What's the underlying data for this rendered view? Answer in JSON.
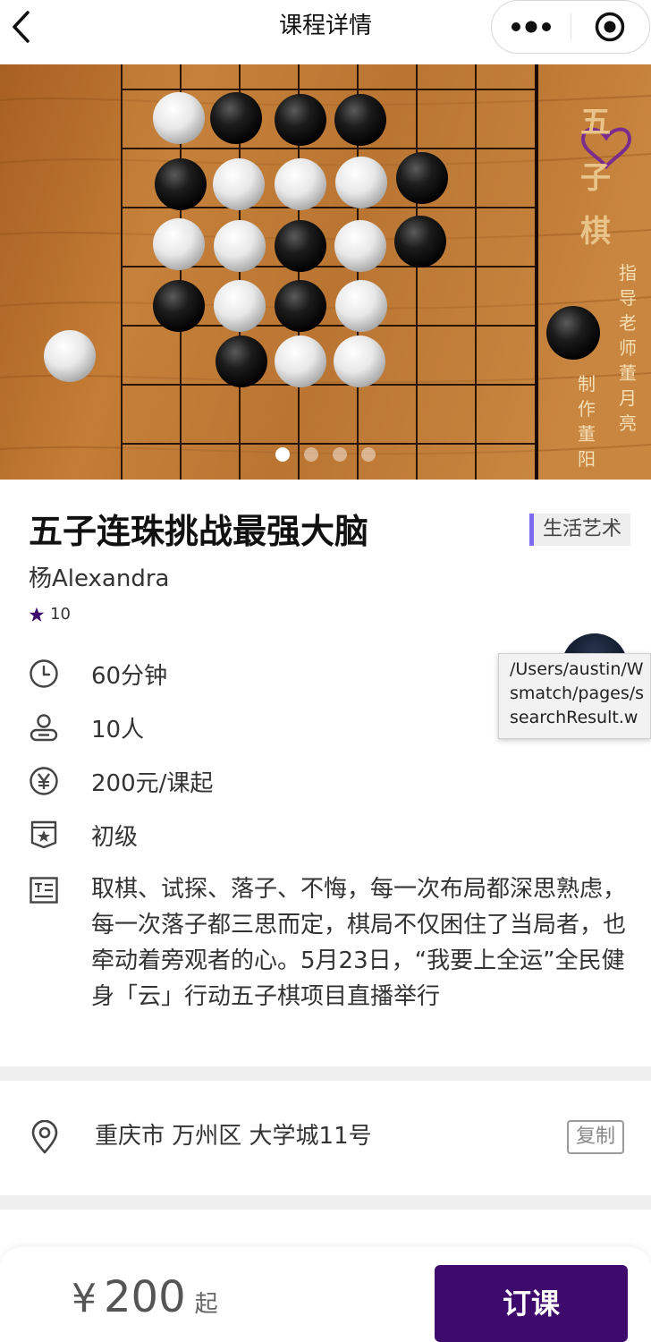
{
  "navbar": {
    "title": "课程详情"
  },
  "banner": {
    "board_title": [
      "五",
      "子",
      "棋"
    ],
    "credit_left": [
      "制",
      "作",
      "董",
      "阳"
    ],
    "credit_right": [
      "指",
      "导",
      "老",
      "师",
      "董",
      "月",
      "亮"
    ],
    "slide_count": 4,
    "active_slide": 1
  },
  "course": {
    "title": "五子连珠挑战最强大脑",
    "category": "生活艺术",
    "teacher": "杨Alexandra",
    "rating": "10",
    "duration": "60分钟",
    "capacity": "10人",
    "price_text": "200元/课起",
    "level": "初级",
    "description": "取棋、试探、落子、不悔，每一次布局都深思熟虑，每一次落子都三思而定，棋局不仅困住了当局者，也牵动着旁观者的心。5月23日，“我要上全运”全民健身「云」行动五子棋项目直播举行"
  },
  "tooltip": {
    "text": "/Users/austin/W\nsmatch/pages/s\nsearchResult.w"
  },
  "address": {
    "text": "重庆市 万州区 大学城11号",
    "copy_label": "复制"
  },
  "bottom": {
    "currency": "¥",
    "amount": "200",
    "suffix": "起",
    "order_label": "订课"
  },
  "colors": {
    "accent": "#3e0a6b",
    "tag_bar": "#7b6cf0",
    "board_wood": "#b36b2a"
  },
  "icons": [
    "back-arrow-icon",
    "more-dots-icon",
    "target-close-icon",
    "star-icon",
    "clock-icon",
    "person-icon",
    "yen-icon",
    "badge-star-icon",
    "document-icon",
    "location-pin-icon",
    "heart-icon"
  ]
}
